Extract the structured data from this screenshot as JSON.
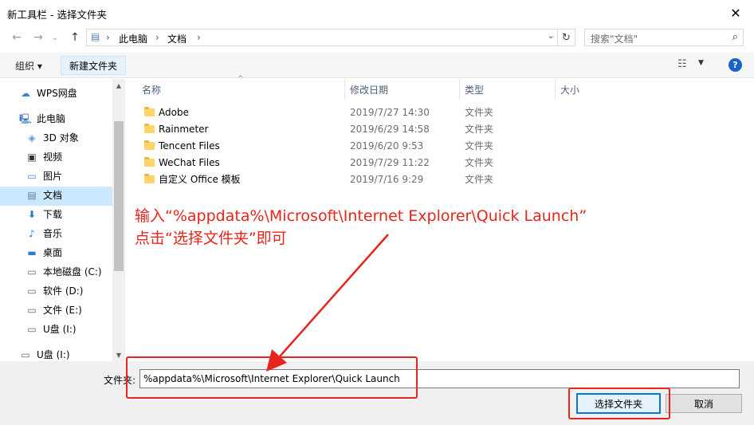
{
  "window": {
    "title": "新工具栏 - 选择文件夹",
    "close_glyph": "✕"
  },
  "nav": {
    "back_glyph": "←",
    "forward_glyph": "→",
    "recent_glyph": "⌄",
    "up_glyph": "↑",
    "breadcrumb": [
      "此电脑",
      "文档"
    ],
    "breadcrumb_sep": "›",
    "refresh_glyph": "↻"
  },
  "search": {
    "placeholder": "搜索\"文档\""
  },
  "toolbar": {
    "organize_label": "组织 ▾",
    "new_folder_label": "新建文件夹"
  },
  "sidebar": {
    "items": [
      {
        "label": "WPS网盘",
        "icon": "cloud-icon"
      },
      {
        "label": "此电脑",
        "icon": "computer-icon"
      },
      {
        "label": "3D 对象",
        "icon": "cube-icon"
      },
      {
        "label": "视频",
        "icon": "video-icon"
      },
      {
        "label": "图片",
        "icon": "picture-icon"
      },
      {
        "label": "文档",
        "icon": "document-icon",
        "selected": true
      },
      {
        "label": "下载",
        "icon": "download-icon"
      },
      {
        "label": "音乐",
        "icon": "music-icon"
      },
      {
        "label": "桌面",
        "icon": "desktop-icon"
      },
      {
        "label": "本地磁盘 (C:)",
        "icon": "drive-icon"
      },
      {
        "label": "软件 (D:)",
        "icon": "drive-icon"
      },
      {
        "label": "文件 (E:)",
        "icon": "drive-icon"
      },
      {
        "label": "U盘 (I:)",
        "icon": "drive-icon"
      },
      {
        "label": "U盘 (I:)",
        "icon": "usb-drive-icon"
      }
    ]
  },
  "columns": {
    "name": "名称",
    "modified": "修改日期",
    "type": "类型",
    "size": "大小"
  },
  "files": [
    {
      "name": "Adobe",
      "modified": "2019/7/27 14:30",
      "type": "文件夹"
    },
    {
      "name": "Rainmeter",
      "modified": "2019/6/29 14:58",
      "type": "文件夹"
    },
    {
      "name": "Tencent Files",
      "modified": "2019/6/20 9:53",
      "type": "文件夹"
    },
    {
      "name": "WeChat Files",
      "modified": "2019/7/29 11:22",
      "type": "文件夹"
    },
    {
      "name": "自定义 Office 模板",
      "modified": "2019/7/16 9:29",
      "type": "文件夹"
    }
  ],
  "annotation": {
    "line1": "输入“%appdata%\\Microsoft\\Internet Explorer\\Quick Launch”",
    "line2": "点击“选择文件夹”即可",
    "color": "#e8251d"
  },
  "footer": {
    "folder_label": "文件夹:",
    "folder_value": "%appdata%\\Microsoft\\Internet Explorer\\Quick Launch",
    "select_button": "选择文件夹",
    "cancel_button": "取消"
  }
}
